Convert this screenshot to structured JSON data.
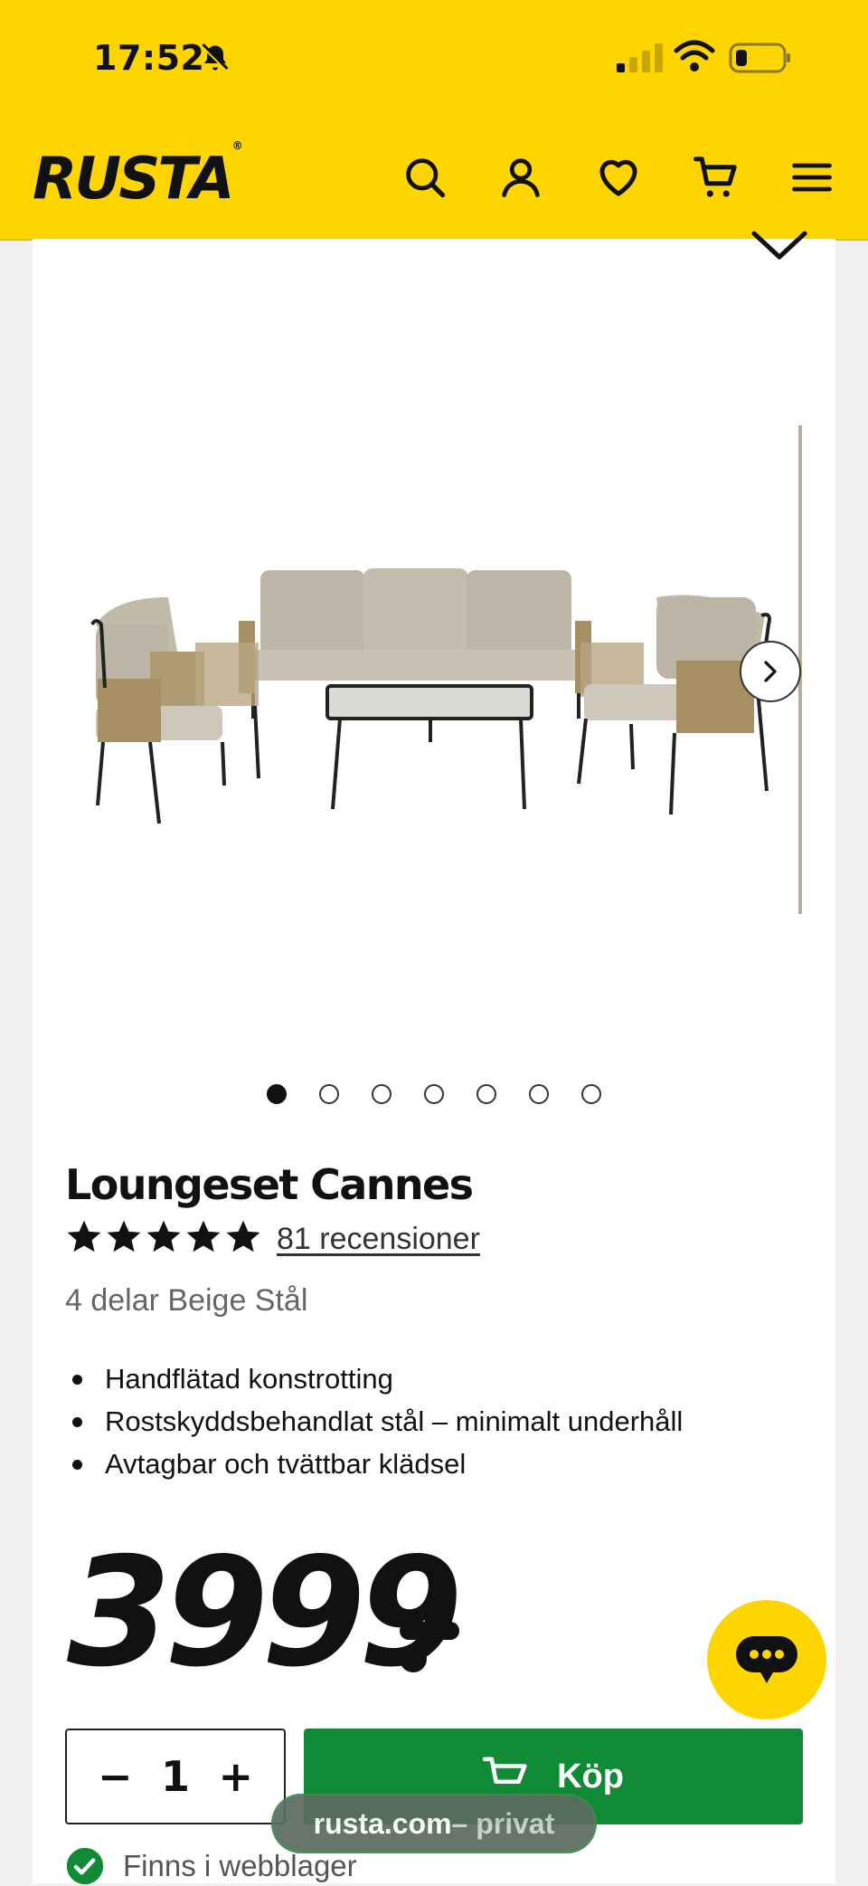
{
  "status_bar": {
    "time": "17:52"
  },
  "header": {
    "logo": "RUSTA",
    "logo_mark": "®"
  },
  "product": {
    "title": "Loungeset Cannes",
    "rating": 5,
    "reviews_link": "81 recensioner",
    "subtitle": "4 delar Beige Stål",
    "features": [
      "Handflätad konstrotting",
      "Rostskyddsbehandlat stål – minimalt underhåll",
      "Avtagbar och tvättbar klädsel"
    ],
    "price": "3999",
    "price_suffix": ":-"
  },
  "gallery": {
    "image_count": 7,
    "active_index": 1
  },
  "purchase": {
    "quantity": "1",
    "decrement": "−",
    "increment": "+",
    "buy_label": "Köp"
  },
  "stock": {
    "status": "Finns i webblager"
  },
  "browser": {
    "url_host": "rusta.com",
    "url_suffix": " – privat"
  },
  "colors": {
    "brand_yellow": "#ffd500",
    "buy_green": "#118a35"
  }
}
